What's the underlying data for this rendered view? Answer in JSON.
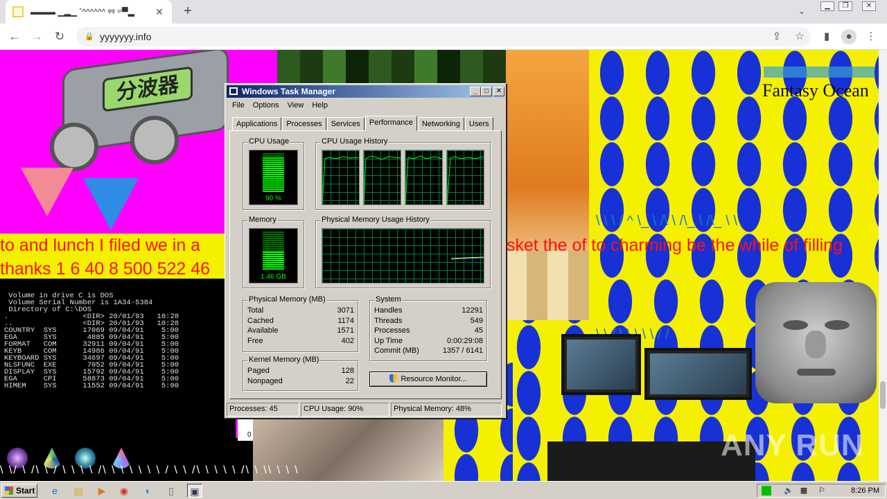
{
  "browser": {
    "tab_title": "▬▬▬ ▁▂▁ ˆ^^^^^^ ᵠᵠ ᵘⁱ▀▂",
    "url": "yyyyyyy.info",
    "icons": [
      "back-icon",
      "forward-icon",
      "reload-icon",
      "lock-icon",
      "share-icon",
      "star-icon",
      "sidebar-icon",
      "profile-icon",
      "menu-icon"
    ]
  },
  "page": {
    "splitter_label": "分波器",
    "fantasy_title": "Fantasy Ocean",
    "red_line_left_1": "to and lunch I filed we in a",
    "red_line_left_2": "thanks 1 6 40 8 500 522 46",
    "red_line_right": "sket the of to charming be the while of filling",
    "slash_text_1": "\\ \\ \\ / ^ \\_ \\ /\\ \\ /\\_ \\ /\\_ \\ \\",
    "slash_text_2": "\\ \\ / \\ \\ \\ \\ \\ / /",
    "bottom_slashes": "\\ \\/ \\ /\\ \\ / \\ \\ \\ \\ /\\ \\ \\ \\ \\ \\ \\ / \\ \\ /\\ \\ \\ \\ \\ /\\ \\ \\\\ \\ \\ \\",
    "dos_header": [
      "Volume in drive C is DOS",
      "Volume Serial Number is 1A34-5384",
      "Directory of C:\\DOS"
    ],
    "dos_rows": [
      [
        ".",
        "",
        "<DIR>",
        "20/01/93",
        "10:28"
      ],
      [
        "..",
        "",
        "<DIR>",
        "20/01/93",
        "10:28"
      ],
      [
        "COUNTRY",
        "SYS",
        "17069",
        "09/04/91",
        "5:00"
      ],
      [
        "EGA",
        "SYS",
        "4885",
        "09/04/91",
        "5:00"
      ],
      [
        "FORMAT",
        "COM",
        "32911",
        "09/04/91",
        "5:00"
      ],
      [
        "KEYB",
        "COM",
        "14986",
        "09/04/91",
        "5:00"
      ],
      [
        "KEYBOARD",
        "SYS",
        "34697",
        "09/04/91",
        "5:00"
      ],
      [
        "NLSFUNC",
        "EXE",
        "7052",
        "09/04/91",
        "5:00"
      ],
      [
        "DISPLAY",
        "SYS",
        "15792",
        "09/04/91",
        "5:00"
      ],
      [
        "EGA",
        "CPI",
        "58873",
        "09/04/91",
        "5:00"
      ],
      [
        "HIMEM",
        "SYS",
        "11552",
        "09/04/91",
        "5:00"
      ]
    ],
    "dos_cursor": "0",
    "watermark": "ANY RUN"
  },
  "taskmgr": {
    "title": "Windows Task Manager",
    "menu": [
      "File",
      "Options",
      "View",
      "Help"
    ],
    "tabs": [
      "Applications",
      "Processes",
      "Services",
      "Performance",
      "Networking",
      "Users"
    ],
    "active_tab": "Performance",
    "cpu_usage_label": "CPU Usage",
    "cpu_usage_value": "90 %",
    "cpu_usage_fraction": 0.9,
    "cpu_history_label": "CPU Usage History",
    "memory_label": "Memory",
    "memory_value": "1.46 GB",
    "memory_fraction": 0.48,
    "pm_history_label": "Physical Memory Usage History",
    "physical_memory": {
      "label": "Physical Memory (MB)",
      "rows": [
        [
          "Total",
          "3071"
        ],
        [
          "Cached",
          "1174"
        ],
        [
          "Available",
          "1571"
        ],
        [
          "Free",
          "402"
        ]
      ]
    },
    "kernel_memory": {
      "label": "Kernel Memory (MB)",
      "rows": [
        [
          "Paged",
          "128"
        ],
        [
          "Nonpaged",
          "22"
        ]
      ]
    },
    "system": {
      "label": "System",
      "rows": [
        [
          "Handles",
          "12291"
        ],
        [
          "Threads",
          "549"
        ],
        [
          "Processes",
          "45"
        ],
        [
          "Up Time",
          "0:00:29:08"
        ],
        [
          "Commit (MB)",
          "1357 / 6141"
        ]
      ]
    },
    "resource_button": "Resource Monitor...",
    "status": {
      "processes": "Processes: 45",
      "cpu": "CPU Usage: 90%",
      "memory": "Physical Memory: 48%"
    }
  },
  "taskbar": {
    "start": "Start",
    "clock": "8:26 PM",
    "colors": {
      "titlebar": "#0a246a",
      "meter": "#00ff00",
      "grid": "#008040"
    }
  }
}
